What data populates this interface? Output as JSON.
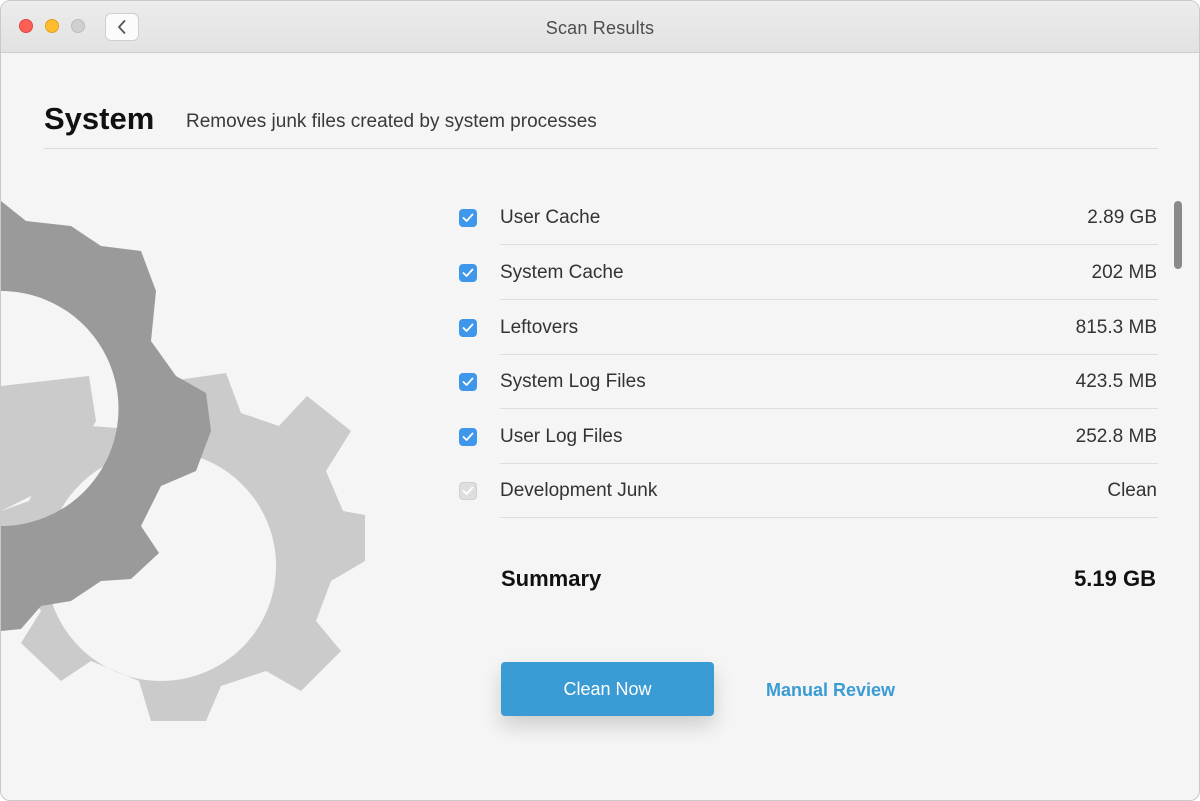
{
  "window": {
    "title": "Scan Results",
    "accent_color": "#3a9bd5",
    "checkbox_color": "#3e97ea"
  },
  "section": {
    "title": "System",
    "description": "Removes junk files created by system processes",
    "illustration_icon": "gears-icon"
  },
  "items": [
    {
      "label": "User Cache",
      "value": "2.89 GB",
      "checked": true
    },
    {
      "label": "System Cache",
      "value": "202 MB",
      "checked": true
    },
    {
      "label": "Leftovers",
      "value": "815.3 MB",
      "checked": true
    },
    {
      "label": "System Log Files",
      "value": "423.5 MB",
      "checked": true
    },
    {
      "label": "User Log Files",
      "value": "252.8 MB",
      "checked": true
    },
    {
      "label": "Development Junk",
      "value": "Clean",
      "checked": true,
      "disabled": true
    }
  ],
  "summary": {
    "label": "Summary",
    "value": "5.19 GB"
  },
  "actions": {
    "clean_label": "Clean Now",
    "review_label": "Manual Review"
  }
}
